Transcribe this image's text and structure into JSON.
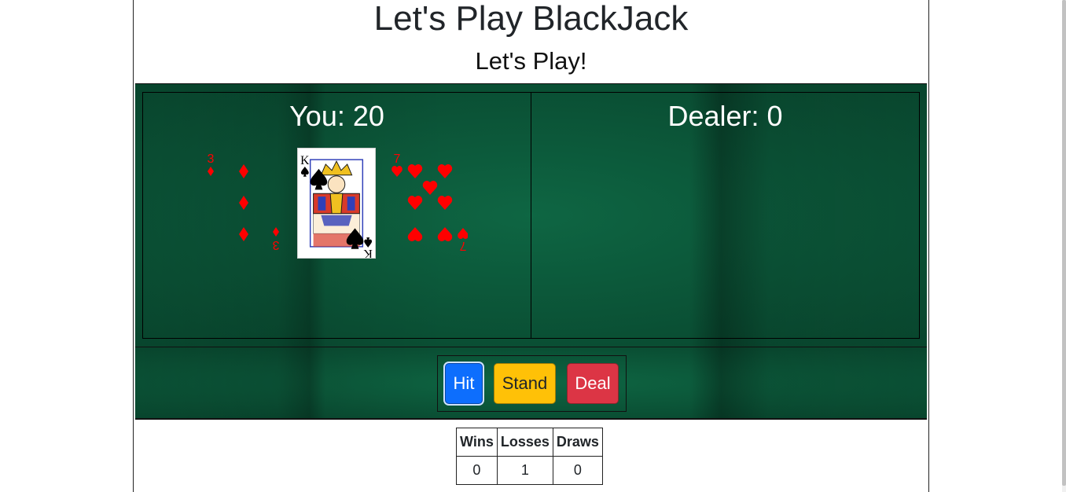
{
  "header": {
    "title": "Let's Play BlackJack",
    "subtitle": "Let's Play!"
  },
  "player": {
    "label": "You: 20",
    "cards": [
      {
        "rank": "3",
        "suit": "diamonds",
        "suit_icon": "diamond-icon",
        "color": "#ff0000",
        "face_up": true
      },
      {
        "rank": "K",
        "suit": "spades",
        "suit_icon": "spade-icon",
        "color": "#000000",
        "face_up": true
      },
      {
        "rank": "7",
        "suit": "hearts",
        "suit_icon": "heart-icon",
        "color": "#ff0000",
        "face_up": true
      }
    ]
  },
  "dealer": {
    "label": "Dealer: 0",
    "cards": []
  },
  "controls": {
    "hit_label": "Hit",
    "stand_label": "Stand",
    "deal_label": "Deal",
    "hit_color": "#0d6efd",
    "stand_color": "#ffc107",
    "deal_color": "#dc3545"
  },
  "scoreboard": {
    "headers": [
      "Wins",
      "Losses",
      "Draws"
    ],
    "values": [
      "0",
      "1",
      "0"
    ]
  },
  "colors": {
    "felt": "#0b5c3c",
    "red_suit": "#ff0000",
    "black_suit": "#000000"
  }
}
